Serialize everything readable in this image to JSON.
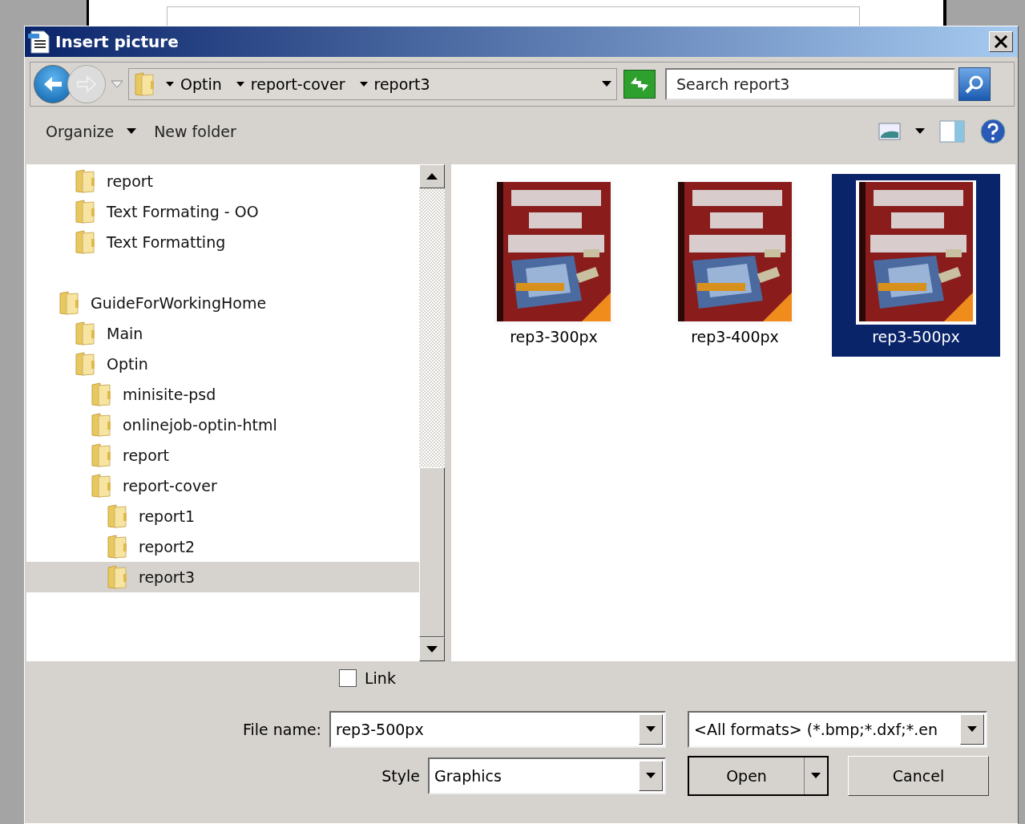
{
  "window": {
    "title": "Insert picture"
  },
  "address_bar": {
    "crumbs": [
      "Optin",
      "report-cover",
      "report3"
    ]
  },
  "search": {
    "placeholder": "Search report3"
  },
  "toolbar": {
    "organize": "Organize",
    "new_folder": "New folder"
  },
  "tree": {
    "partial_group": [
      {
        "label": "report",
        "selected": false
      },
      {
        "label": "Text Formating - OO",
        "selected": false
      },
      {
        "label": "Text Formatting",
        "selected": false
      }
    ],
    "items": [
      {
        "label": "GuideForWorkingHome",
        "selected": false,
        "children": [
          {
            "label": "Main",
            "selected": false
          },
          {
            "label": "Optin",
            "selected": false,
            "children": [
              {
                "label": "minisite-psd",
                "selected": false
              },
              {
                "label": "onlinejob-optin-html",
                "selected": false
              },
              {
                "label": "report",
                "selected": false
              },
              {
                "label": "report-cover",
                "selected": false,
                "children": [
                  {
                    "label": "report1",
                    "selected": false
                  },
                  {
                    "label": "report2",
                    "selected": false
                  },
                  {
                    "label": "report3",
                    "selected": true
                  }
                ]
              }
            ]
          }
        ]
      }
    ]
  },
  "files": [
    {
      "name": "rep3-300px",
      "selected": false
    },
    {
      "name": "rep3-400px",
      "selected": false
    },
    {
      "name": "rep3-500px",
      "selected": true
    }
  ],
  "link": {
    "label": "Link",
    "checked": false
  },
  "file_name": {
    "label": "File name:",
    "value": "rep3-500px"
  },
  "filter": {
    "value": "<All formats> (*.bmp;*.dxf;*.en"
  },
  "style": {
    "label": "Style",
    "value": "Graphics"
  },
  "buttons": {
    "open": "Open",
    "cancel": "Cancel"
  }
}
